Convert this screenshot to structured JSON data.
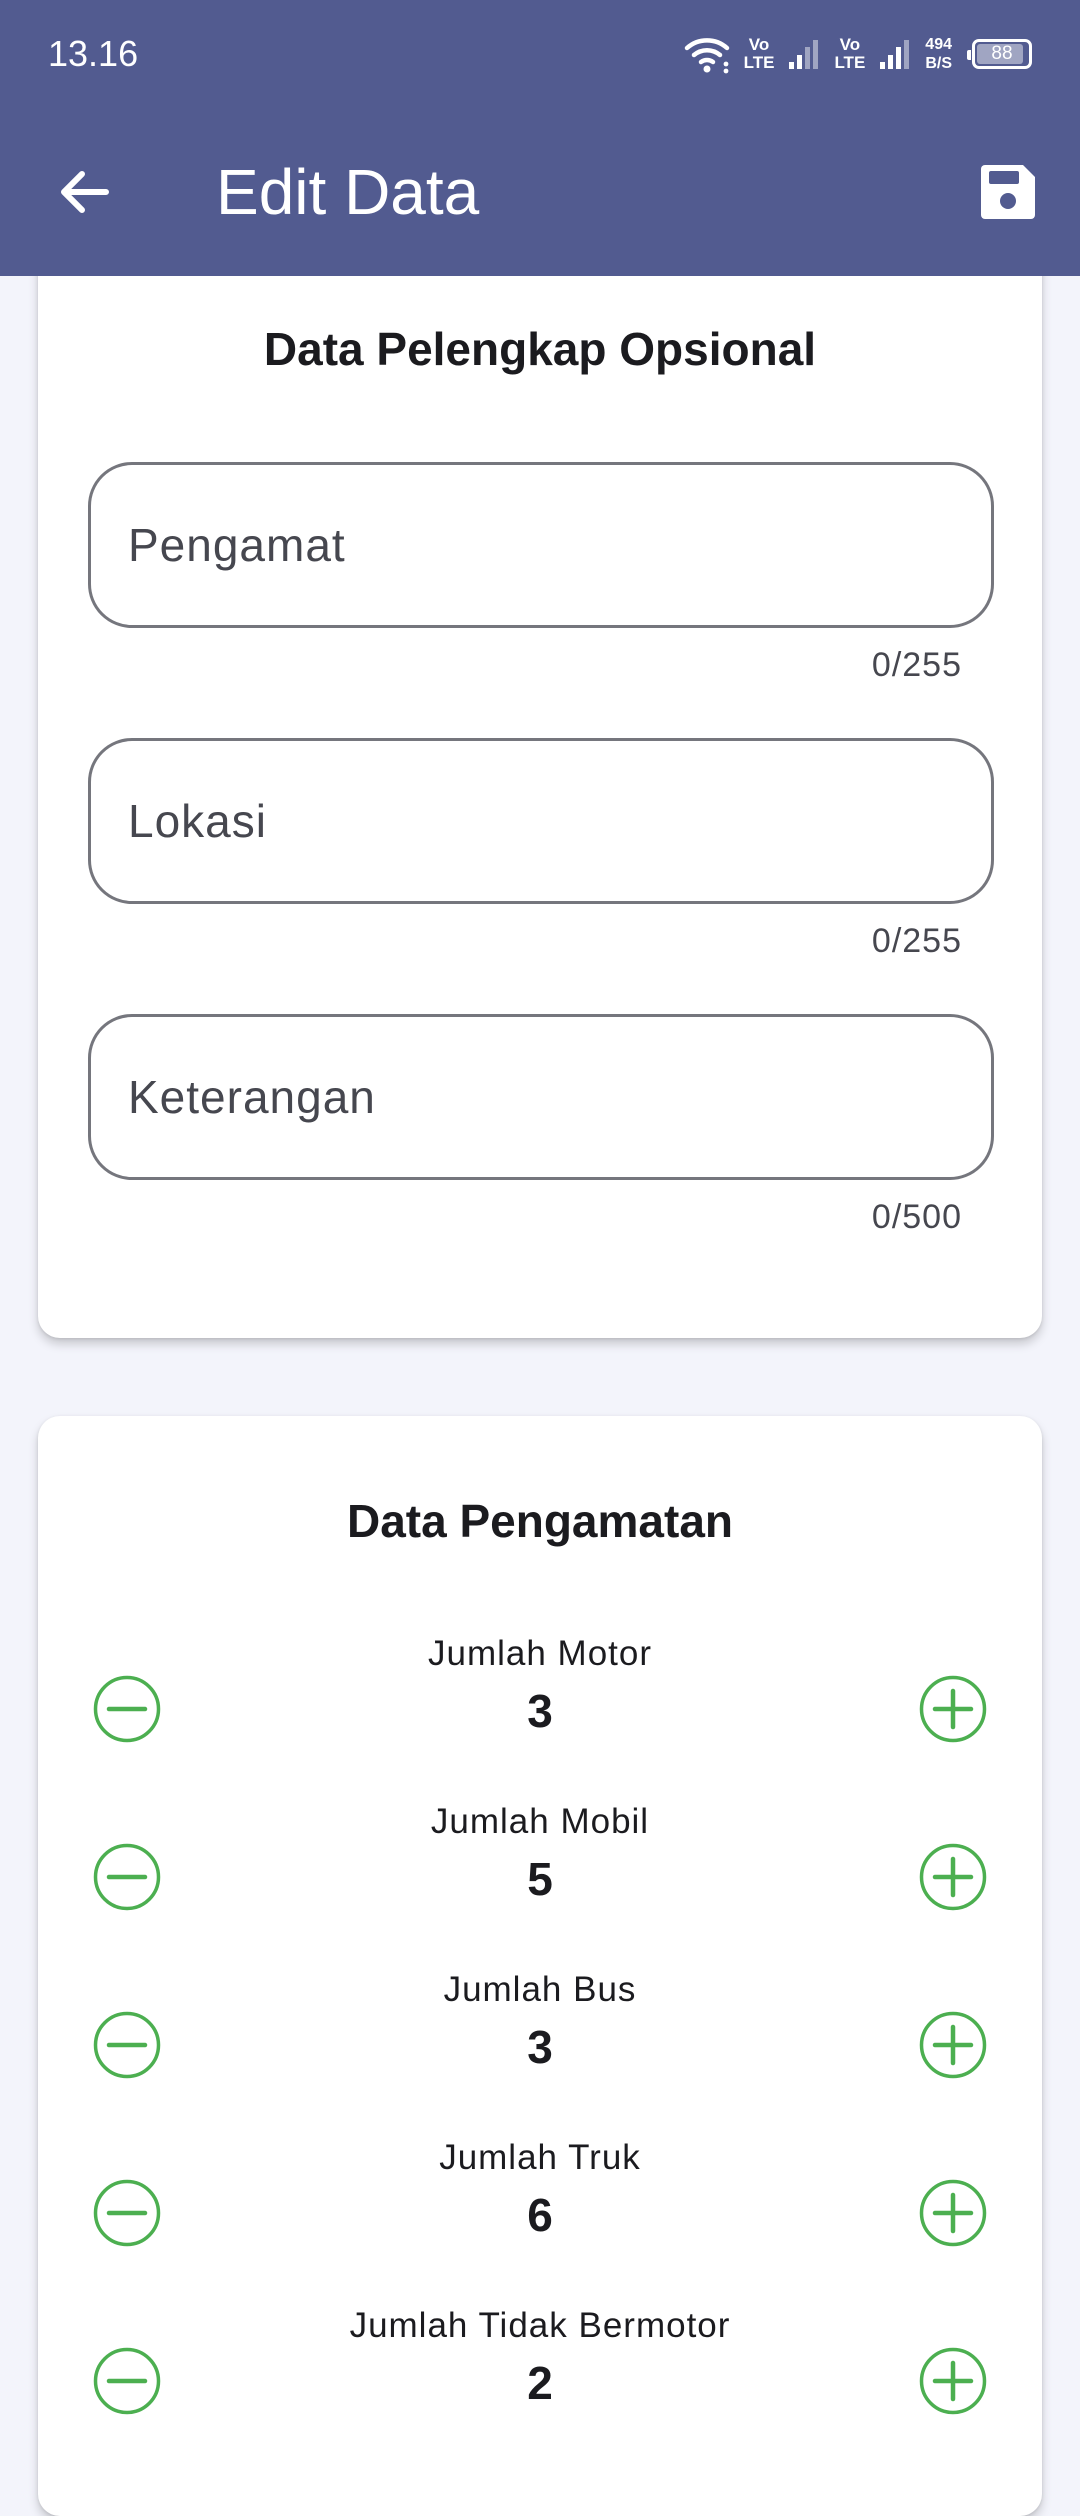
{
  "status_bar": {
    "time": "13.16",
    "volte1_top": "Vo",
    "volte1_bottom": "LTE",
    "volte2_top": "Vo",
    "volte2_bottom": "LTE",
    "net_speed_value": "494",
    "net_speed_unit": "B/S",
    "battery": "88"
  },
  "app_bar": {
    "title": "Edit Data",
    "back_icon": "arrow-left-icon",
    "save_icon": "floppy-disk-icon",
    "background_color": "#525b90"
  },
  "optional_section": {
    "title": "Data Pelengkap Opsional",
    "fields": [
      {
        "placeholder": "Pengamat",
        "value": "",
        "counter": "0/255"
      },
      {
        "placeholder": "Lokasi",
        "value": "",
        "counter": "0/255"
      },
      {
        "placeholder": "Keterangan",
        "value": "",
        "counter": "0/500"
      }
    ]
  },
  "observation_section": {
    "title": "Data Pengamatan",
    "accent_color": "#4caf50",
    "minus_icon": "minus-circle-icon",
    "plus_icon": "plus-circle-icon",
    "counters": [
      {
        "label": "Jumlah Motor",
        "value": "3"
      },
      {
        "label": "Jumlah Mobil",
        "value": "5"
      },
      {
        "label": "Jumlah Bus",
        "value": "3"
      },
      {
        "label": "Jumlah Truk",
        "value": "6"
      },
      {
        "label": "Jumlah Tidak Bermotor",
        "value": "2"
      }
    ]
  }
}
